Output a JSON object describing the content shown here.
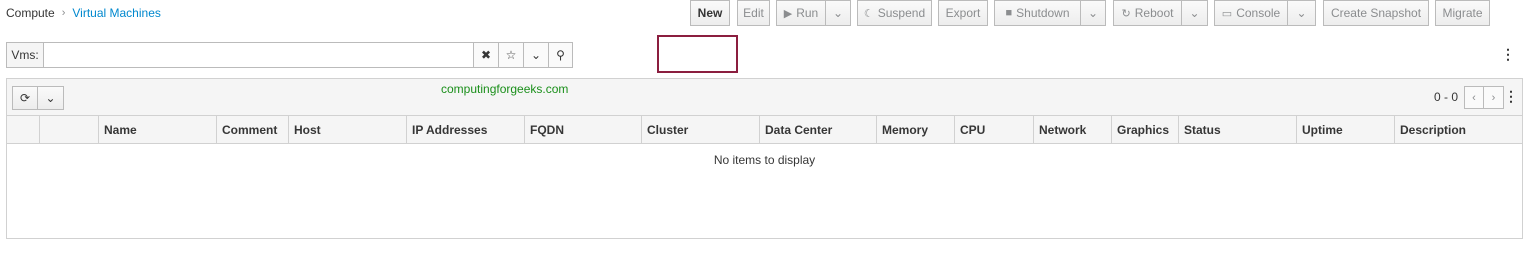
{
  "breadcrumb": {
    "root": "Compute",
    "separator": "›",
    "current": "Virtual Machines"
  },
  "search": {
    "prefix": "Vms:",
    "value": "",
    "placeholder": "",
    "clear_icon": "✖",
    "bookmark_icon": "☆",
    "dropdown_icon": "⌄",
    "search_icon": "⚲"
  },
  "toolbar": {
    "new_label": "New",
    "edit_label": "Edit",
    "run_label": "Run",
    "run_icon": "▶",
    "suspend_label": "Suspend",
    "suspend_icon": "☾",
    "export_label": "Export",
    "shutdown_label": "Shutdown",
    "shutdown_icon": "■",
    "reboot_label": "Reboot",
    "reboot_icon": "↻",
    "console_label": "Console",
    "console_icon": "▭",
    "snapshot_label": "Create Snapshot",
    "migrate_label": "Migrate",
    "caret": "⌄",
    "kebab": "⋮"
  },
  "grid": {
    "refresh_icon": "⟳",
    "refresh_caret": "⌄",
    "watermark": "computingforgeeks.com",
    "pager_count": "0 - 0",
    "pager_prev": "‹",
    "pager_next": "›",
    "kebab": "⋮",
    "columns": [
      "Name",
      "Comment",
      "Host",
      "IP Addresses",
      "FQDN",
      "Cluster",
      "Data Center",
      "Memory",
      "CPU",
      "Network",
      "Graphics",
      "Status",
      "Uptime",
      "Description"
    ],
    "empty_message": "No items to display"
  },
  "colors": {
    "link": "#0088ce",
    "highlight_border": "#8b1e3f",
    "watermark": "#1a8f1a"
  }
}
